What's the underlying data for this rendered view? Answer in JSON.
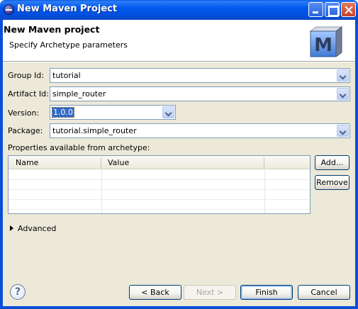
{
  "window": {
    "title": "New Maven Project"
  },
  "header": {
    "title": "New Maven project",
    "subtitle": "Specify Archetype parameters",
    "logo_letter": "M"
  },
  "form": {
    "group_id": {
      "label": "Group Id:",
      "value": "tutorial"
    },
    "artifact_id": {
      "label": "Artifact Id:",
      "value": "simple_router"
    },
    "version": {
      "label": "Version:",
      "value": "1.0.0"
    },
    "package": {
      "label": "Package:",
      "value": "tutorial.simple_router"
    }
  },
  "properties": {
    "label": "Properties available from archetype:",
    "columns": [
      "Name",
      "Value"
    ],
    "rows": [],
    "add_label": "Add...",
    "remove_label": "Remove"
  },
  "advanced": {
    "label": "Advanced"
  },
  "footer": {
    "help_glyph": "?",
    "back_label": "< Back",
    "next_label": "Next >",
    "finish_label": "Finish",
    "cancel_label": "Cancel"
  },
  "colors": {
    "titlebar": "#0058ee",
    "dialog_bg": "#ece9d8",
    "selection": "#316ac5"
  }
}
